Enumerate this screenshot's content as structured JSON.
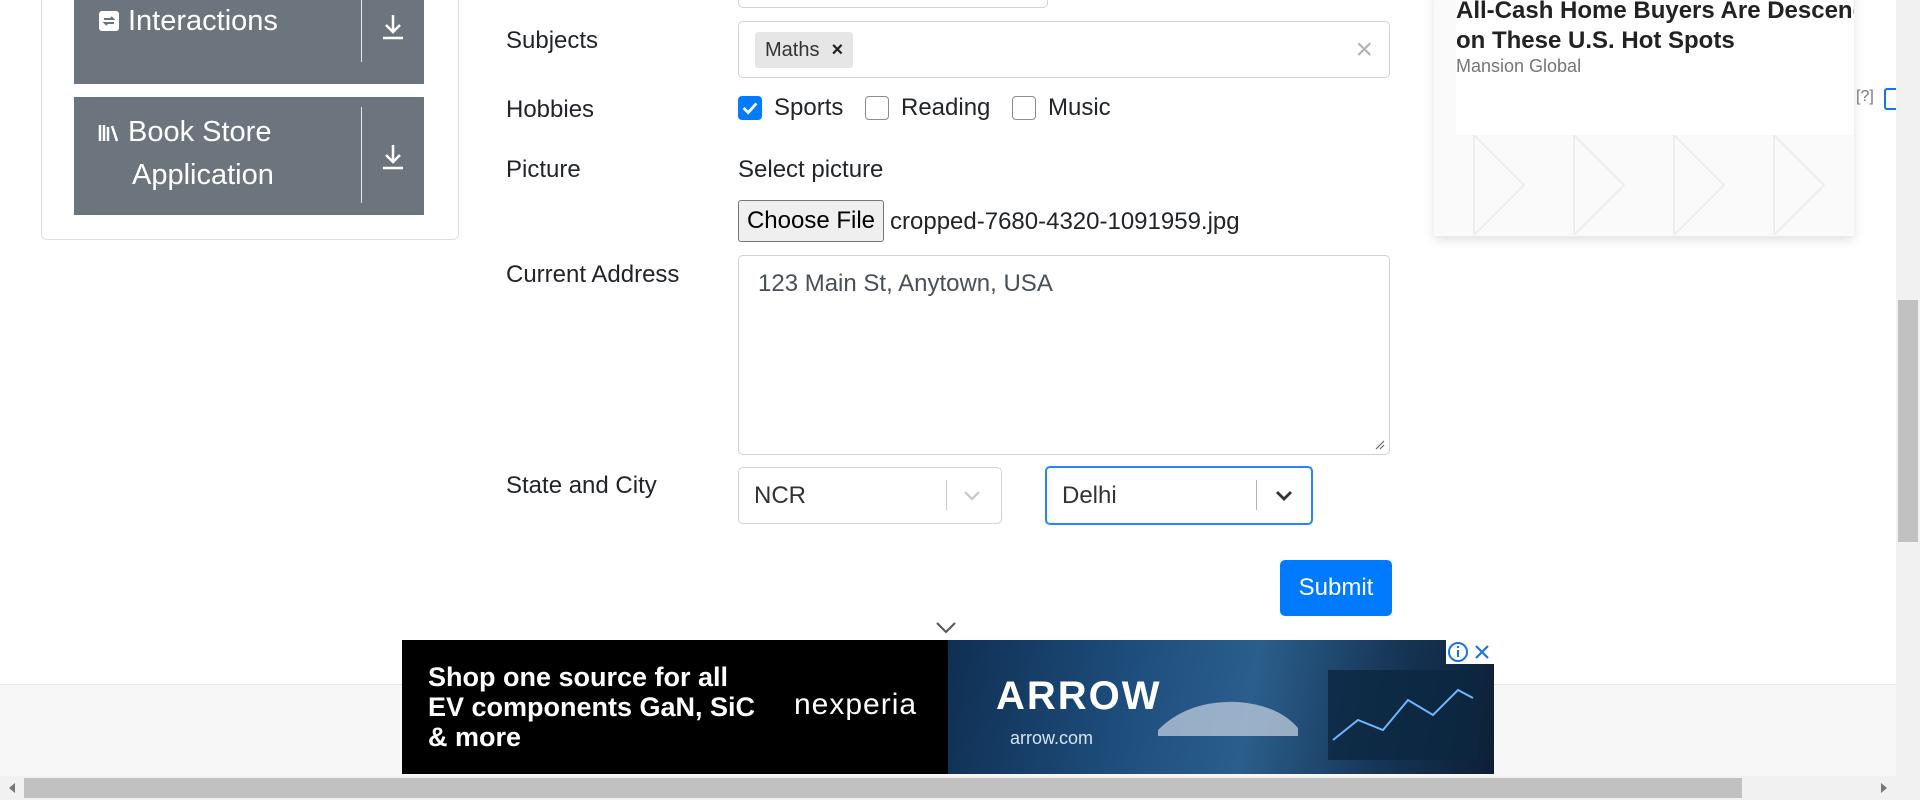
{
  "sidebar": {
    "items": [
      {
        "label": "Interactions",
        "icon": "interactions-icon"
      },
      {
        "label_line1": "Book Store",
        "label_line2": "Application",
        "icon": "book-store-icon"
      }
    ]
  },
  "form": {
    "subjects": {
      "label": "Subjects",
      "chips": [
        "Maths"
      ]
    },
    "hobbies": {
      "label": "Hobbies",
      "options": [
        {
          "label": "Sports",
          "checked": true
        },
        {
          "label": "Reading",
          "checked": false
        },
        {
          "label": "Music",
          "checked": false
        }
      ]
    },
    "picture": {
      "label": "Picture",
      "hint": "Select picture",
      "button": "Choose File",
      "filename": "cropped-7680-4320-1091959.jpg"
    },
    "address": {
      "label": "Current Address",
      "value": "123 Main St, Anytown, USA"
    },
    "state_city": {
      "label": "State and City",
      "state": "NCR",
      "city": "Delhi"
    },
    "submit": "Submit"
  },
  "ad_card": {
    "title_line1": "All-Cash Home Buyers Are Descending",
    "title_line2": "on These U.S. Hot Spots",
    "source": "Mansion Global",
    "info": "[?]"
  },
  "banner": {
    "line1": "Shop one source for all",
    "line2": "EV components GaN, SiC",
    "line3": "& more",
    "brand": "nexperia",
    "logo": "ARROW",
    "sub": "arrow.com"
  },
  "colors": {
    "primary": "#007bff",
    "sidebar": "#6c757d"
  }
}
